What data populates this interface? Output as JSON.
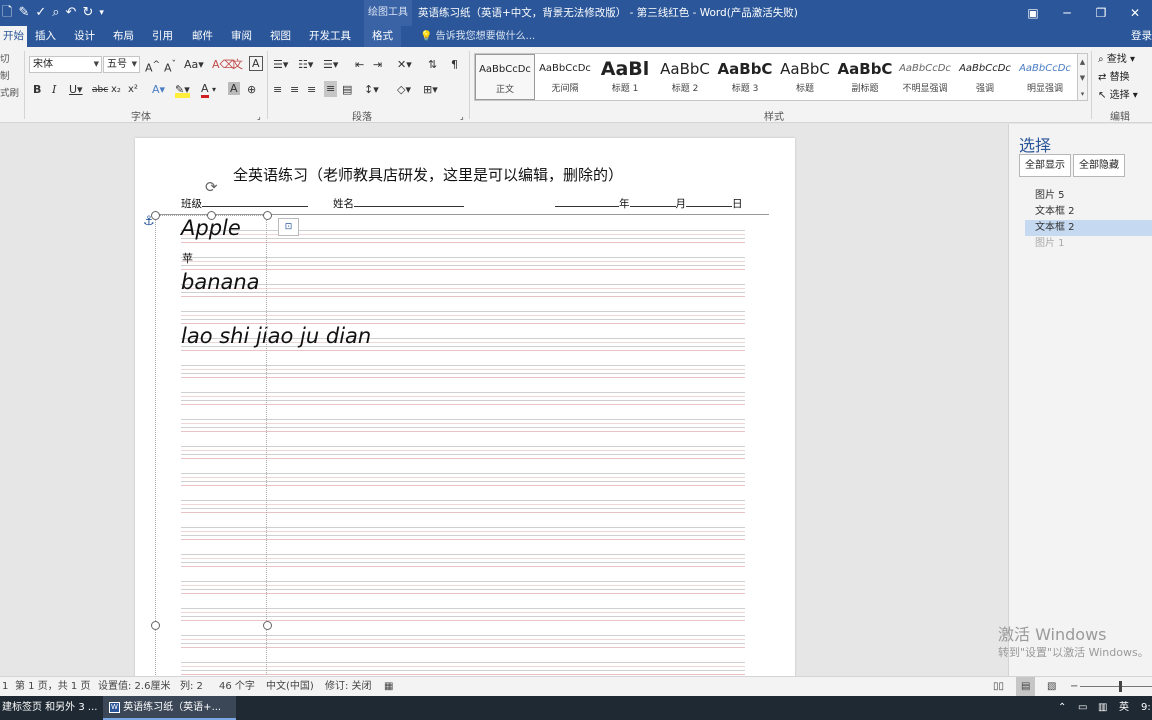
{
  "title_bar": {
    "context_tool_group": "绘图工具",
    "document_title": "英语练习纸（英语+中文，背景无法修改版） - 第三线红色 - Word(产品激活失败)"
  },
  "tabs": [
    {
      "id": "home",
      "label": "开始"
    },
    {
      "id": "insert",
      "label": "插入"
    },
    {
      "id": "design",
      "label": "设计"
    },
    {
      "id": "layout",
      "label": "布局"
    },
    {
      "id": "references",
      "label": "引用"
    },
    {
      "id": "mailings",
      "label": "邮件"
    },
    {
      "id": "review",
      "label": "审阅"
    },
    {
      "id": "view",
      "label": "视图"
    },
    {
      "id": "developer",
      "label": "开发工具"
    },
    {
      "id": "format",
      "label": "格式"
    }
  ],
  "tell_me_placeholder": "告诉我您想要做什么...",
  "sign_in": "登录",
  "clipboard": {
    "cut": "切",
    "copy": "制",
    "format_painter": "式刷"
  },
  "font": {
    "name": "宋体",
    "size": "五号",
    "group_label": "字体"
  },
  "paragraph": {
    "group_label": "段落"
  },
  "styles": {
    "group_label": "样式",
    "items": [
      {
        "preview": "AaBbCcDc",
        "name": "正文"
      },
      {
        "preview": "AaBbCcDc",
        "name": "无间隔"
      },
      {
        "preview": "AaBl",
        "name": "标题 1"
      },
      {
        "preview": "AaBbC",
        "name": "标题 2"
      },
      {
        "preview": "AaBbC",
        "name": "标题 3"
      },
      {
        "preview": "AaBbC",
        "name": "标题"
      },
      {
        "preview": "AaBbC",
        "name": "副标题"
      },
      {
        "preview": "AaBbCcDc",
        "name": "不明显强调"
      },
      {
        "preview": "AaBbCcDc",
        "name": "强调"
      },
      {
        "preview": "AaBbCcDc",
        "name": "明显强调"
      }
    ]
  },
  "editing": {
    "find": "查找",
    "replace": "替换",
    "select": "选择",
    "group_label": "编辑"
  },
  "document": {
    "title": "全英语练习（老师教具店研发，这里是可以编辑，删除的）",
    "class_label": "班级",
    "name_label": "姓名",
    "year_label": "年",
    "month_label": "月",
    "day_label": "日",
    "lines": {
      "apple": "Apple",
      "chinese": "苹",
      "banana": "banana",
      "pinyin": "lao shi jiao ju dian"
    }
  },
  "selection_pane": {
    "title": "选择",
    "show_all": "全部显示",
    "hide_all": "全部隐藏",
    "items": [
      "图片 5",
      "文本框 2",
      "文本框 2",
      "图片 1"
    ]
  },
  "watermark": {
    "line1": "激活 Windows",
    "line2": "转到\"设置\"以激活 Windows。"
  },
  "status_bar": {
    "section": "1",
    "page": "第 1 页，共 1 页",
    "setting": "设置值: 2.6厘米",
    "column": "列: 2",
    "word_count": "46 个字",
    "language": "中文(中国)",
    "track_changes": "修订: 关闭"
  },
  "taskbar": {
    "item1": "建标签页 和另外 3 ...",
    "item2": "英语练习纸（英语+...",
    "ime": "英",
    "clock": "9:"
  }
}
